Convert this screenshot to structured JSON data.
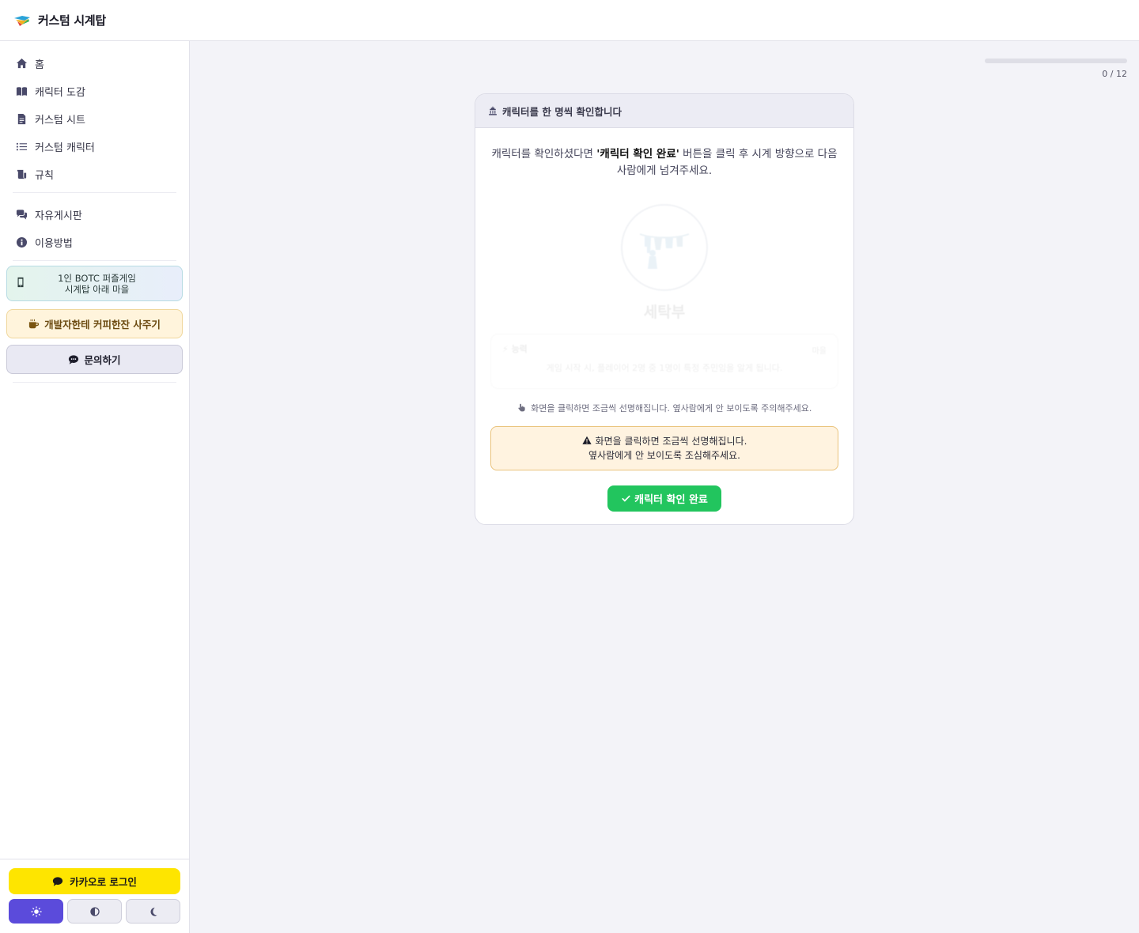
{
  "app": {
    "title": "커스텀 시계탑"
  },
  "sidebar": {
    "items": [
      {
        "label": "홈",
        "icon": "home-icon"
      },
      {
        "label": "캐릭터 도감",
        "icon": "book-icon"
      },
      {
        "label": "커스텀 시트",
        "icon": "document-icon"
      },
      {
        "label": "커스텀 캐릭터",
        "icon": "list-icon"
      },
      {
        "label": "규칙",
        "icon": "scroll-icon"
      }
    ],
    "items2": [
      {
        "label": "자유게시판",
        "icon": "comments-icon"
      },
      {
        "label": "이용방법",
        "icon": "info-icon"
      }
    ],
    "promo": {
      "line1": "1인 BOTC 퍼즐게임",
      "line2": "시계탑 아래 마을"
    },
    "coffee_label": "개발자한테 커피한잔 사주기",
    "inquiry_label": "문의하기",
    "login_label": "카카오로 로그인",
    "theme_options": [
      "light",
      "auto",
      "dark"
    ],
    "theme_selected": "light"
  },
  "progress": {
    "current": 0,
    "total": 12,
    "label": "0 / 12"
  },
  "card": {
    "header": "캐릭터를 한 명씩 확인합니다",
    "instruction_pre": "캐릭터를 확인하셨다면 ",
    "instruction_bold": "'캐릭터 확인 완료'",
    "instruction_post": " 버튼을 클릭 후 시계 방향으로 다음 사람에게 넘겨주세요.",
    "character_name": "세탁부",
    "ability_header": "능력",
    "ability_tag": "마을",
    "ability_text": "게임 시작 시, 플레이어 2명 중 1명이 특정 주민임을 알게 됩니다.",
    "click_hint": "화면을 클릭하면 조금씩 선명해집니다. 옆사람에게 안 보이도록 주의해주세요.",
    "warning_line1": "화면을 클릭하면 조금씩 선명해집니다.",
    "warning_line2": "옆사람에게 안 보이도록 조심해주세요.",
    "confirm_label": "캐릭터 확인 완료"
  },
  "colors": {
    "accent": "#5b4bdb",
    "confirm": "#22c55e",
    "kakao": "#fee500",
    "warning_bg": "#fff3e0"
  }
}
